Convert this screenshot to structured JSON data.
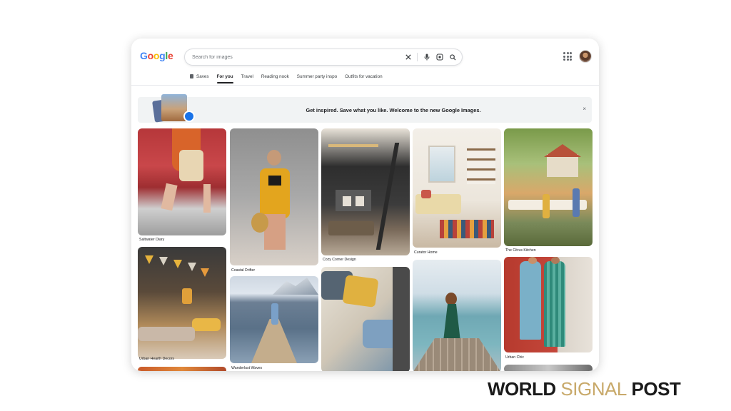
{
  "logo": {
    "letters": [
      "G",
      "o",
      "o",
      "g",
      "l",
      "e"
    ],
    "colors": [
      "#4285F4",
      "#EA4335",
      "#FBBC05",
      "#4285F4",
      "#34A853",
      "#EA4335"
    ]
  },
  "search": {
    "placeholder": "Search for images",
    "value": ""
  },
  "icons": {
    "clear": "close-icon",
    "voice": "microphone-icon",
    "lens": "camera-lens-icon",
    "search": "search-icon",
    "apps": "apps-grid-icon"
  },
  "tabs": [
    {
      "label": "Saves",
      "icon": "bookmark-icon"
    },
    {
      "label": "For you",
      "active": true
    },
    {
      "label": "Travel"
    },
    {
      "label": "Reading nook"
    },
    {
      "label": "Summer party inspo"
    },
    {
      "label": "Outfits for vacation"
    }
  ],
  "banner": {
    "text": "Get inspired. Save what you like. Welcome to the new Google Images.",
    "close": "×"
  },
  "cards": [
    {
      "caption": "Saltwater Diary",
      "theme": "red-stairs-dress"
    },
    {
      "caption": "Urban Hearth Decors",
      "theme": "boho-bunting-party"
    },
    {
      "caption": "",
      "theme": "warm-lights"
    },
    {
      "caption": "Coastal Drifter",
      "theme": "yellow-outfit"
    },
    {
      "caption": "Wanderlust Waves",
      "theme": "lake-pier"
    },
    {
      "caption": "Cozy Corner Design",
      "theme": "loft-interior"
    },
    {
      "caption": "",
      "theme": "yellow-pillows"
    },
    {
      "caption": "Curator Home",
      "theme": "bright-room"
    },
    {
      "caption": "",
      "theme": "green-dress-pier"
    },
    {
      "caption": "The Citrus Kitchen",
      "theme": "garden-party"
    },
    {
      "caption": "Urban Chic",
      "theme": "two-women-red-wall"
    },
    {
      "caption": "",
      "theme": "partial-image"
    }
  ],
  "watermark": {
    "part1": "WORLD ",
    "part2": "SIGNAL",
    "part3": " POST"
  }
}
